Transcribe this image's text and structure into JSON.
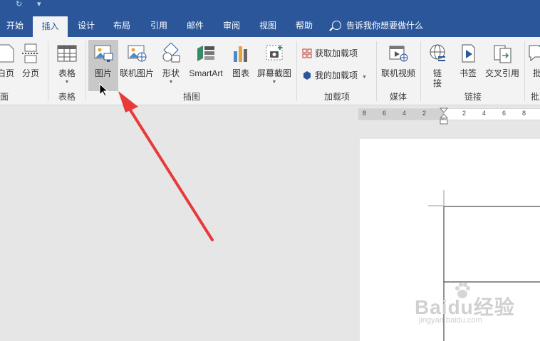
{
  "tabs": [
    {
      "label": "开始"
    },
    {
      "label": "插入",
      "active": true
    },
    {
      "label": "设计"
    },
    {
      "label": "布局"
    },
    {
      "label": "引用"
    },
    {
      "label": "邮件"
    },
    {
      "label": "审阅"
    },
    {
      "label": "视图"
    },
    {
      "label": "帮助"
    }
  ],
  "tell_me": "告诉我你想要做什么",
  "ribbon": {
    "pages": {
      "cover_label": "白页",
      "break_label": "分页",
      "group_label": "面"
    },
    "tables": {
      "table_label": "表格",
      "group_label": "表格"
    },
    "illustrations": {
      "pictures_label": "图片",
      "online_pictures_label": "联机图片",
      "shapes_label": "形状",
      "smartart_label": "SmartArt",
      "chart_label": "图表",
      "screenshot_label": "屏幕截图",
      "group_label": "插图"
    },
    "addins": {
      "get_label": "获取加载项",
      "my_label": "我的加载项",
      "group_label": "加载项"
    },
    "media": {
      "online_video_label": "联机视频",
      "group_label": "媒体"
    },
    "links": {
      "link_label": "链\n接",
      "bookmark_label": "书签",
      "cross_ref_label": "交叉引用",
      "group_label": "链接"
    },
    "comments": {
      "label": "批",
      "group_label": "批"
    }
  },
  "ruler_numbers": [
    "8",
    "6",
    "4",
    "2",
    "2",
    "4",
    "6",
    "8"
  ],
  "watermark": {
    "brand": "Baidu经验",
    "url": "jingyan.baidu.com"
  },
  "colors": {
    "accent": "#2b579a",
    "ribbon_bg": "#f3f3f3",
    "arrow": "#e83a3a"
  }
}
